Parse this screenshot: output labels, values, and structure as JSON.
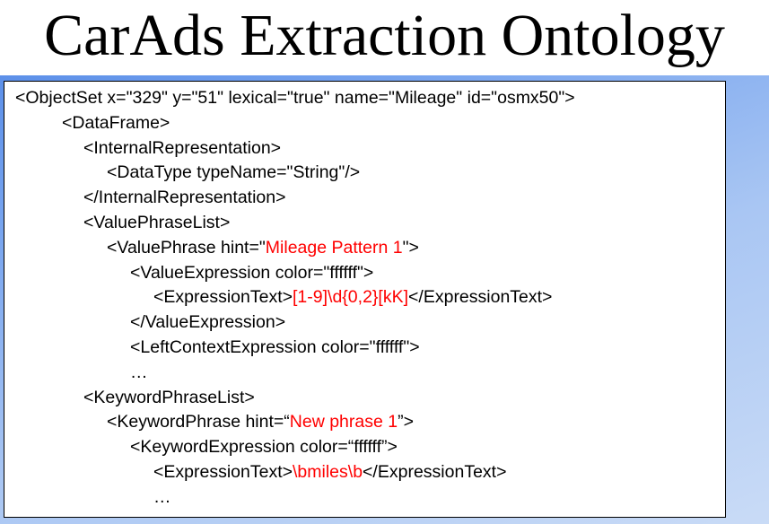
{
  "title": "CarAds Extraction Ontology",
  "colors": {
    "highlight": "#ff0000",
    "text": "#000000"
  },
  "lines": [
    {
      "text": "<ObjectSet x=\"329\" y=\"51\" lexical=\"true\" name=\"Mileage\" id=\"osmx50\">"
    },
    {
      "text": "<DataFrame>"
    },
    {
      "text": "<InternalRepresentation>"
    },
    {
      "text": "<DataType typeName=\"String\"/>"
    },
    {
      "text": "</InternalRepresentation>"
    },
    {
      "text": "<ValuePhraseList>"
    },
    {
      "before": "<ValuePhrase hint=\"",
      "hl": "Mileage Pattern 1",
      "after": "\">"
    },
    {
      "text": "<ValueExpression color=\"ffffff\">"
    },
    {
      "before": "<ExpressionText>",
      "hl": "[1-9]\\d{0,2}[kK]",
      "after": "</ExpressionText>"
    },
    {
      "text": "</ValueExpression>"
    },
    {
      "text": "<LeftContextExpression color=\"ffffff\">"
    },
    {
      "text": "…"
    },
    {
      "text": "<KeywordPhraseList>"
    },
    {
      "before": "<KeywordPhrase hint=“",
      "hl": "New phrase 1",
      "after": "”>"
    },
    {
      "text": "<KeywordExpression color=“ffffff”>"
    },
    {
      "before": "<ExpressionText>",
      "hl": "\\bmiles\\b",
      "after": "</ExpressionText>"
    },
    {
      "text": "…"
    }
  ]
}
